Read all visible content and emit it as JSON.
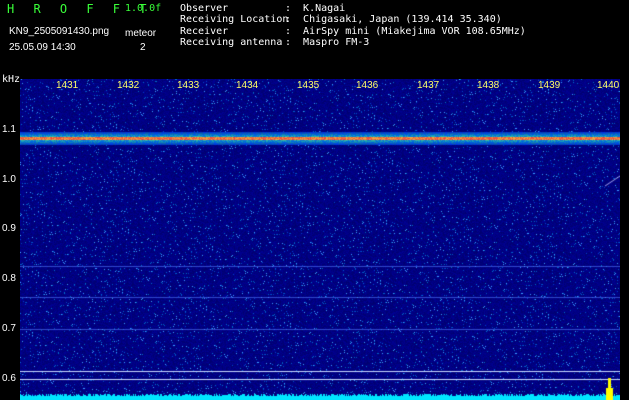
{
  "header": {
    "app_title": "H R O F F T",
    "version": "1.0.0f",
    "filename": "KN9_2505091430.png",
    "meteor_label": "meteor",
    "meteor_count": "2",
    "datetime": "25.05.09 14:30"
  },
  "info": [
    {
      "label": "Observer",
      "value": ":  K.Nagai"
    },
    {
      "label": "Receiving Location",
      "value": ":  Chigasaki, Japan (139.414 35.340)"
    },
    {
      "label": "Receiver",
      "value": ":  AirSpy mini (Miakejima VOR 108.65MHz)"
    },
    {
      "label": "Receiving antenna",
      "value": ":  Maspro FM-3"
    }
  ],
  "y_axis": {
    "unit": "kHz",
    "ticks": [
      "1.1",
      "1.0",
      "0.9",
      "0.8",
      "0.7",
      "0.6"
    ]
  },
  "x_axis": {
    "ticks": [
      "1431",
      "1432",
      "1433",
      "1434",
      "1435",
      "1436",
      "1437",
      "1438",
      "1439",
      "1440"
    ]
  },
  "colors": {
    "background": "#000000",
    "title_green": "#39ff39",
    "waterfall_base": "#00008c",
    "carrier_line": "#ff3b3b",
    "spectrum_trace": "#00e5ff",
    "meteor_peak": "#ffff00"
  }
}
